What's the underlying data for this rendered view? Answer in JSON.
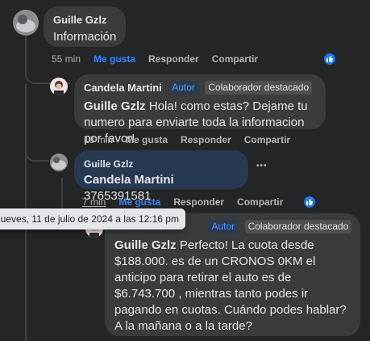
{
  "comments": [
    {
      "author": "Guille Gzlz",
      "text": "Información",
      "time": "55 min",
      "actions": {
        "like": "Me gusta",
        "reply": "Responder",
        "share": "Compartir"
      }
    },
    {
      "author": "Candela Martini",
      "badge_author": "Autor",
      "badge_featured": "Colaborador destacado",
      "mention": "Guille Gzlz",
      "text": " Hola! como estas? Dejame tu numero para enviarte toda la informacion por favor!",
      "time": "18 min",
      "actions": {
        "like": "Me gusta",
        "reply": "Responder",
        "share": "Compartir"
      }
    },
    {
      "author": "Guille Gzlz",
      "mention": "Candela Martini",
      "text": " 3765391581",
      "time": "7 min",
      "more": "•••",
      "actions": {
        "like": "Me gusta",
        "reply": "Responder",
        "share": "Compartir"
      }
    },
    {
      "badge_author": "Autor",
      "badge_featured": "Colaborador destacado",
      "mention": "Guille Gzlz",
      "text": " Perfecto! La cuota desde $188.000. es de un CRONOS 0KM el anticipo para retirar el auto es de $6.743.700 , mientras tanto podes ir pagando en cuotas. Cuándo podes hablar? A la mañana o a la tarde?"
    }
  ],
  "tooltip": "jueves, 11 de julio de 2024 a las 12:16 pm",
  "colors": {
    "link": "#2d88ff",
    "like_badge": "#1877f2",
    "bubble": "#3a3b3c",
    "highlight": "#263951"
  },
  "icons": [
    "avatar-photo",
    "thumbs-up-icon",
    "more-options-icon"
  ]
}
